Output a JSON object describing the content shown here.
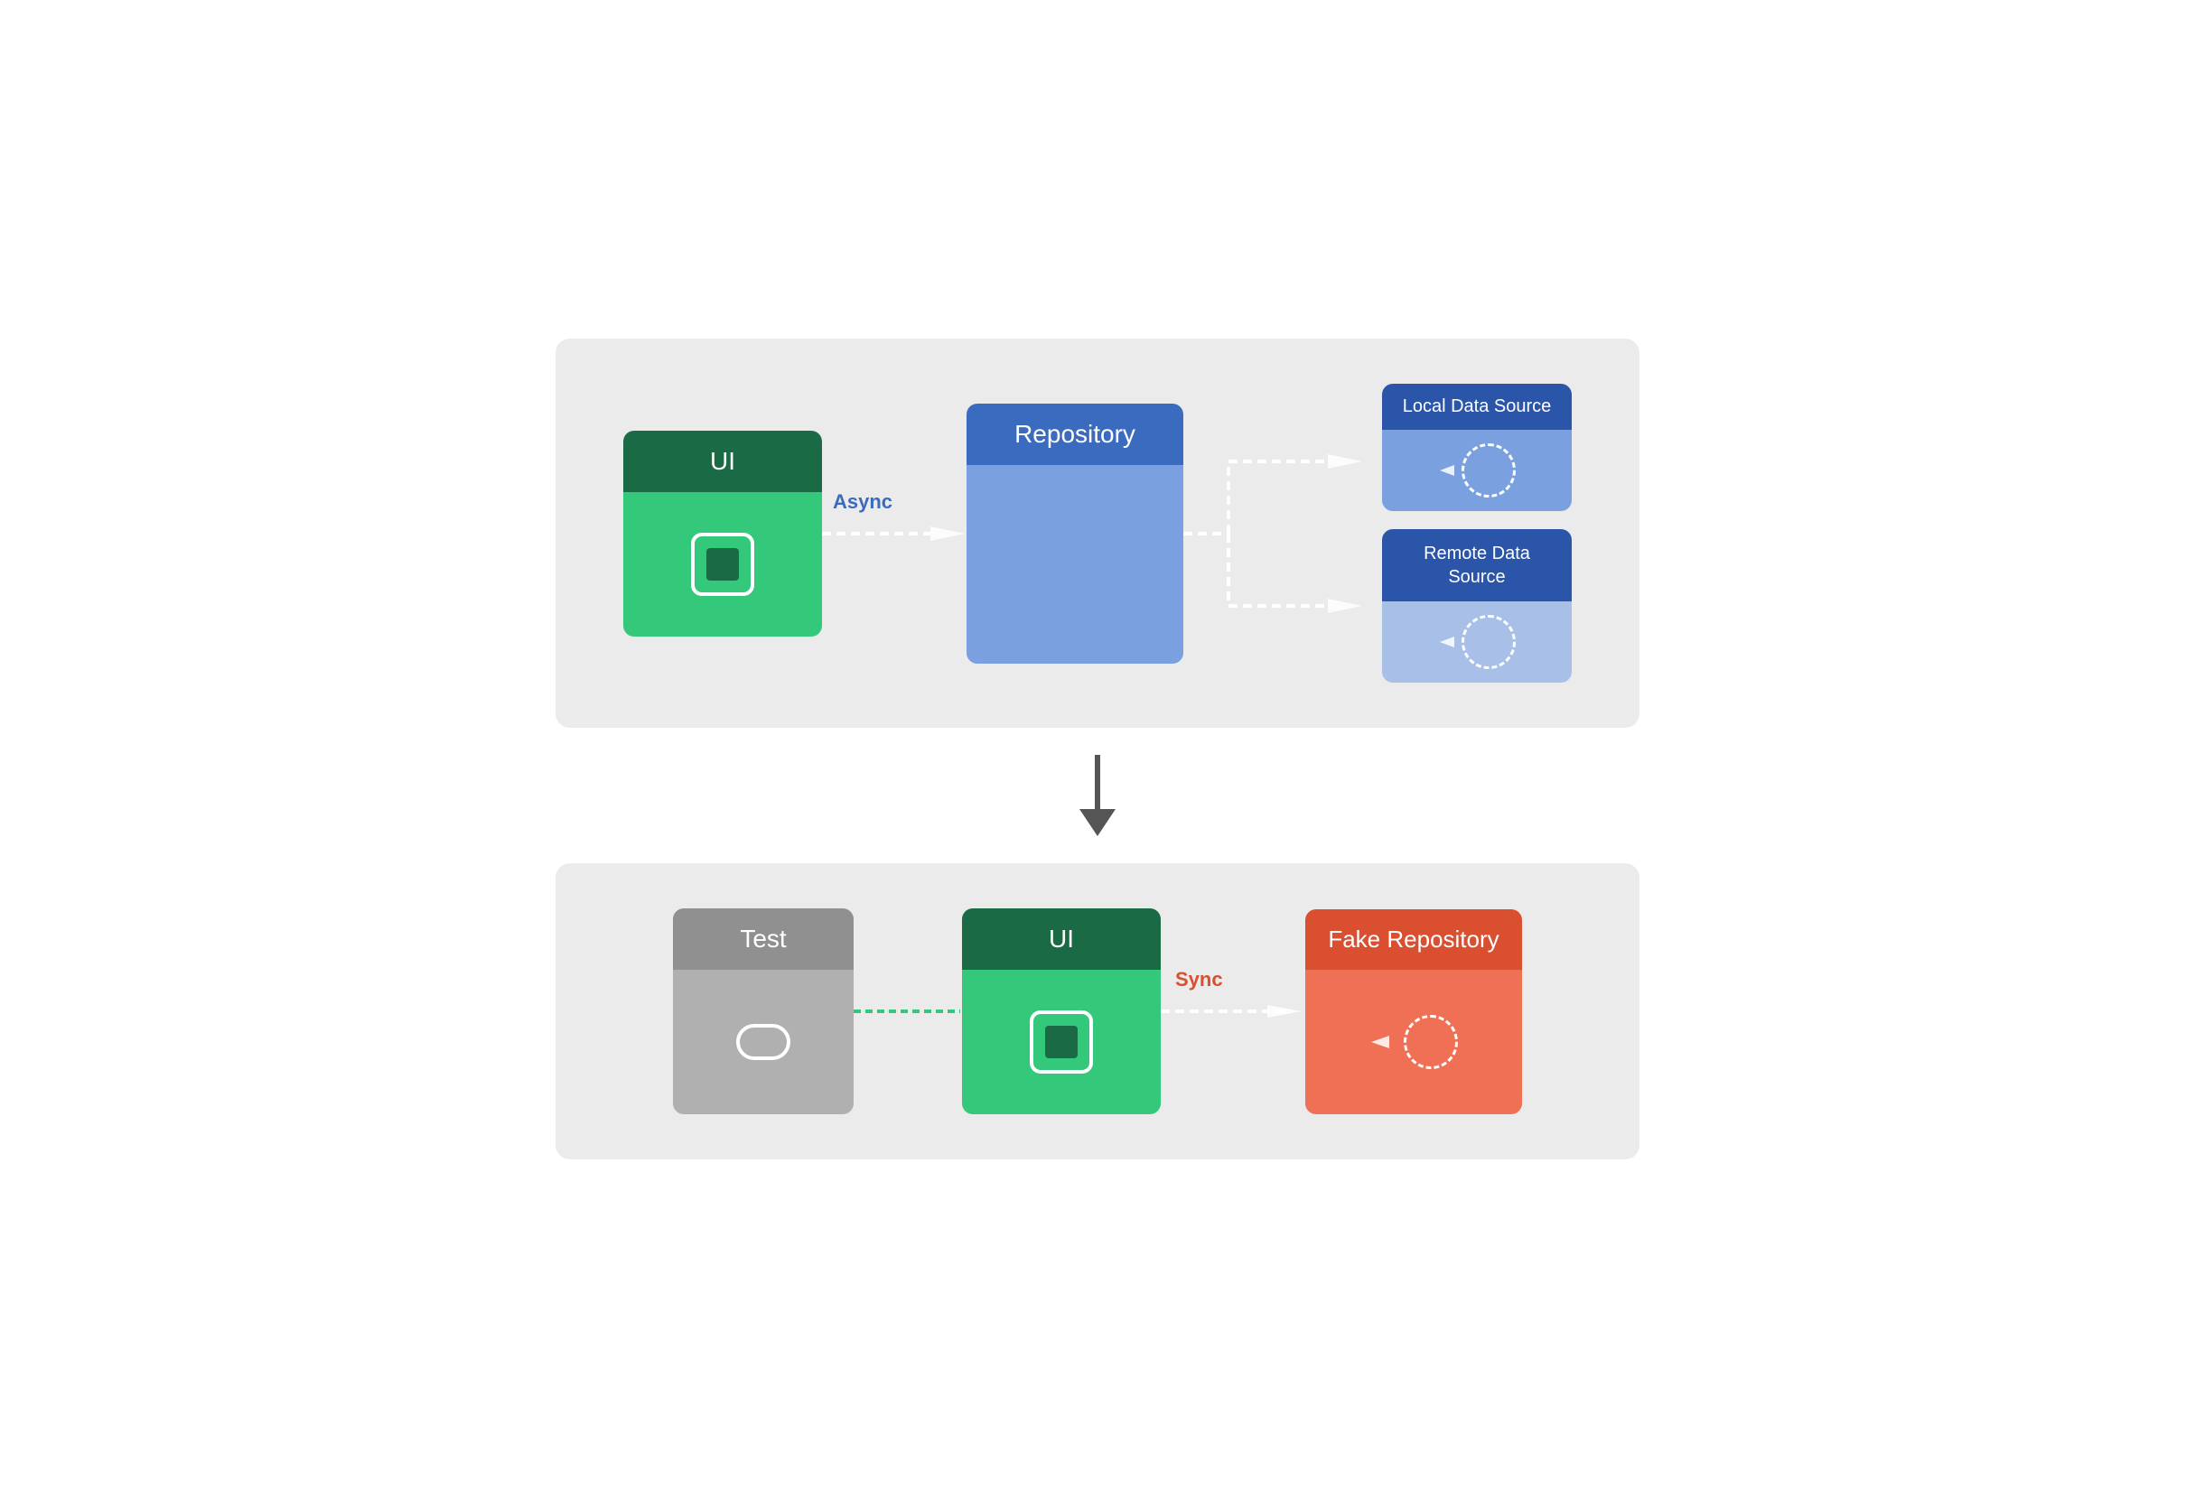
{
  "top_diagram": {
    "ui_label": "UI",
    "repo_label": "Repository",
    "async_label": "Async",
    "local_ds_label": "Local Data Source",
    "remote_ds_label": "Remote Data\nSource"
  },
  "bottom_diagram": {
    "test_label": "Test",
    "ui_label": "UI",
    "fake_repo_label": "Fake Repository",
    "sync_label": "Sync"
  },
  "arrow_down": "↓",
  "colors": {
    "dark_green": "#1a6b45",
    "green": "#34c97a",
    "dark_blue_header": "#2a55a8",
    "blue_repo_header": "#3a6bbf",
    "blue_repo_body": "#7aa0e0",
    "blue_ds_lighter": "#a8bfe8",
    "orange_header": "#d94f30",
    "orange_body": "#f07055",
    "gray_header": "#909090",
    "gray_body": "#b0b0b0"
  }
}
